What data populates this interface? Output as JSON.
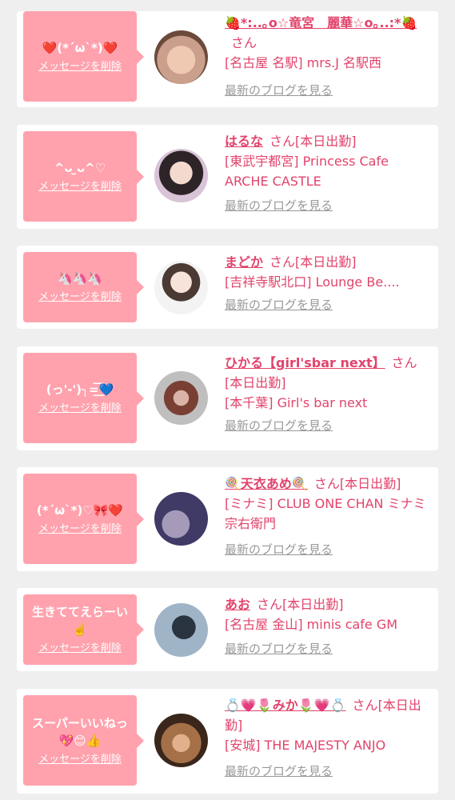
{
  "common": {
    "delete_label": "メッセージを削除",
    "san": "さん",
    "blog_link": "最新のブログを見る"
  },
  "cards": [
    {
      "message": "❤️(*´ω`*)❤️",
      "name": "🍓*:..｡o☆竜宮　麗華☆o｡..:*🍓",
      "status": "",
      "shop": "[名古屋 名駅] mrs.J 名駅西",
      "avatar_colors": [
        "#caa08c",
        "#6b4a3c"
      ]
    },
    {
      "message": "^ᴗ ̫ᴗ^♡",
      "name": "はるな",
      "status": "[本日出勤]",
      "shop": "[東武宇都宮] Princess Cafe ARCHE CASTLE",
      "avatar_colors": [
        "#d9c3d6",
        "#2d2428"
      ]
    },
    {
      "message": "🦄🦄🦄",
      "name": "まどか",
      "status": "[本日出勤]",
      "shop": "[吉祥寺駅北口] Lounge Be....",
      "avatar_colors": [
        "#f3f3f3",
        "#4a3a33"
      ]
    },
    {
      "message": "(っ'-')╮=͟͟͞͞💙",
      "name": "ひかる【girl'sbar next】",
      "status": "[本日出勤]",
      "shop": "[本千葉] Girl's bar next",
      "avatar_colors": [
        "#bfbfbf",
        "#7a3f33"
      ]
    },
    {
      "message": "(*´ω`*)♡🎀❤️",
      "name": "🍭天衣あめ🍭",
      "status": "[本日出勤]",
      "shop": "[ミナミ] CLUB ONE CHAN ミナミ 宗右衛門",
      "avatar_colors": [
        "#3f3a66",
        "#a59ab8"
      ]
    },
    {
      "message": "生きててえらーい☝️",
      "name": "あお",
      "status": "[本日出勤]",
      "shop": "[名古屋 金山] minis cafe GM",
      "avatar_colors": [
        "#9fb4c7",
        "#2a3440"
      ]
    },
    {
      "message": "スーパーいいねっ💖😊👍",
      "name": "💍💗🌷みか🌷💗💍",
      "status": "[本日出勤]",
      "shop": "[安城] THE MAJESTY ANJO",
      "avatar_colors": [
        "#a57047",
        "#3a261a"
      ]
    }
  ]
}
